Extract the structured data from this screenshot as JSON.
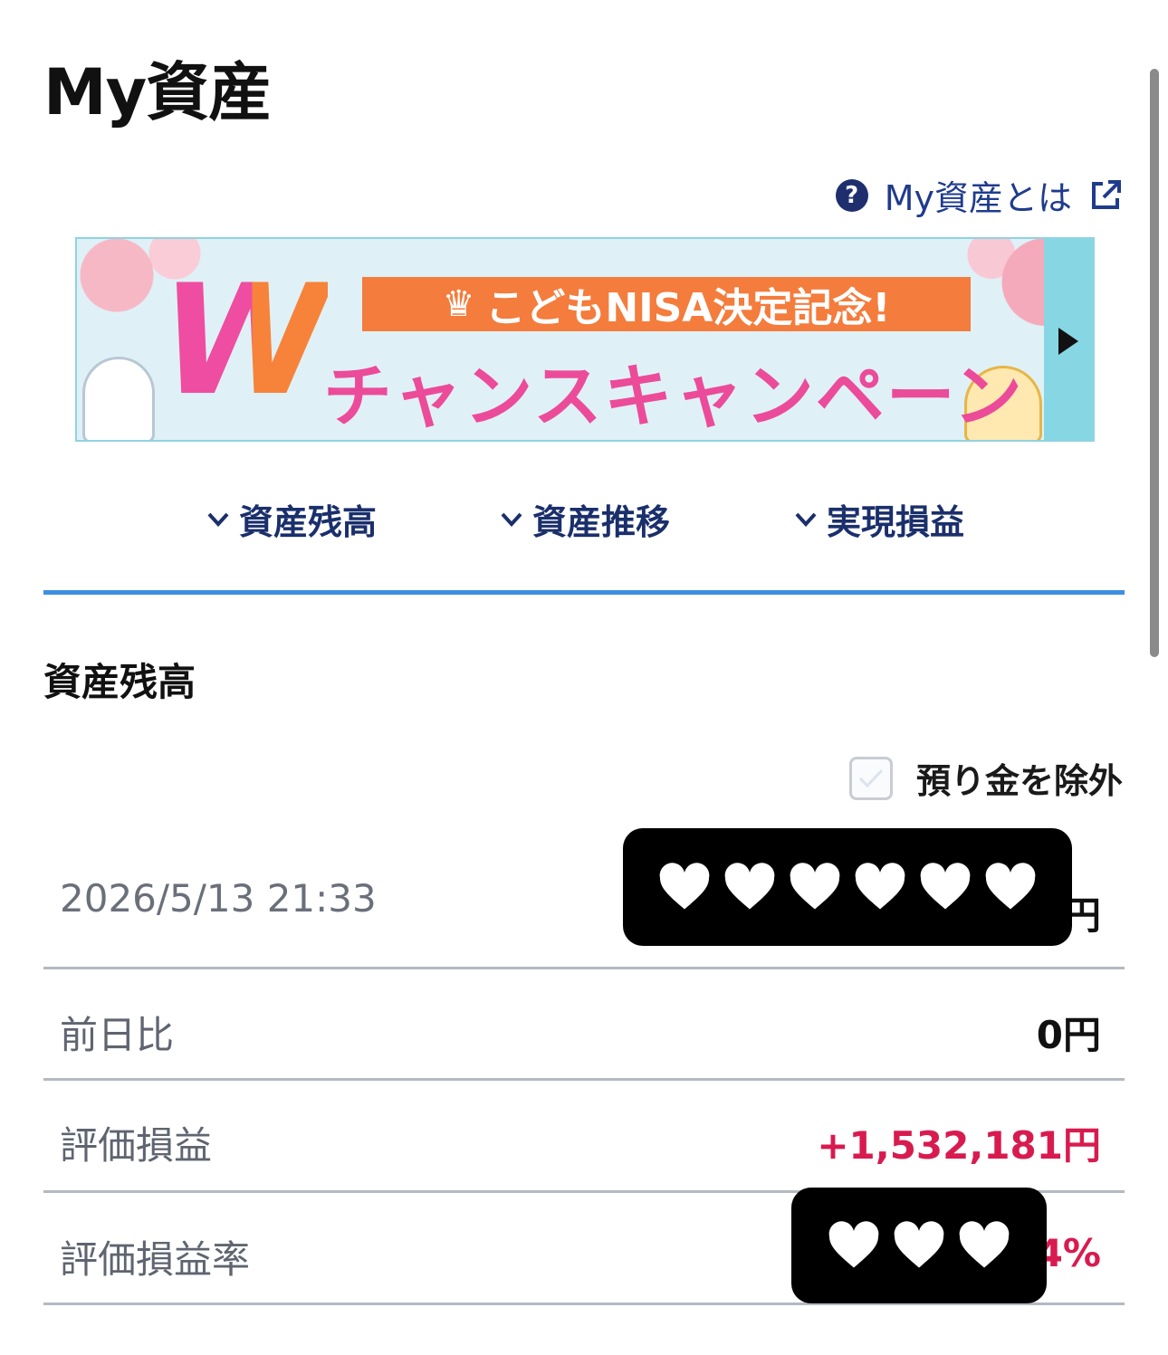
{
  "page": {
    "title": "My資産"
  },
  "help": {
    "label": "My資産とは",
    "icon": "question-circle-icon",
    "external_icon": "external-link-icon"
  },
  "banner": {
    "big_letter": "W",
    "tag_text": "こどもNISA決定記念!",
    "main_text": "チャンスキャンペーン",
    "next_icon": "play-triangle-icon"
  },
  "anchors": [
    {
      "label": "資産残高",
      "icon": "chevron-down-icon"
    },
    {
      "label": "資産推移",
      "icon": "chevron-down-icon"
    },
    {
      "label": "実現損益",
      "icon": "chevron-down-icon"
    }
  ],
  "balance": {
    "section_title": "資産残高",
    "exclude_label": "預り金を除外",
    "exclude_checked": false,
    "rows": [
      {
        "label": "2026/5/13 21:33",
        "value_suffix": "円"
      },
      {
        "label": "前日比",
        "value": "0円"
      },
      {
        "label": "評価損益",
        "value": "+1,532,181円"
      },
      {
        "label": "評価損益率",
        "value_suffix": "4%"
      }
    ]
  },
  "colors": {
    "link_navy": "#1a2f6b",
    "accent_blue": "#3d8fe0",
    "gain_red": "#d81b4f",
    "banner_pink": "#ec4b9a",
    "banner_orange": "#f47c3c",
    "banner_bg": "#dff1f6"
  }
}
